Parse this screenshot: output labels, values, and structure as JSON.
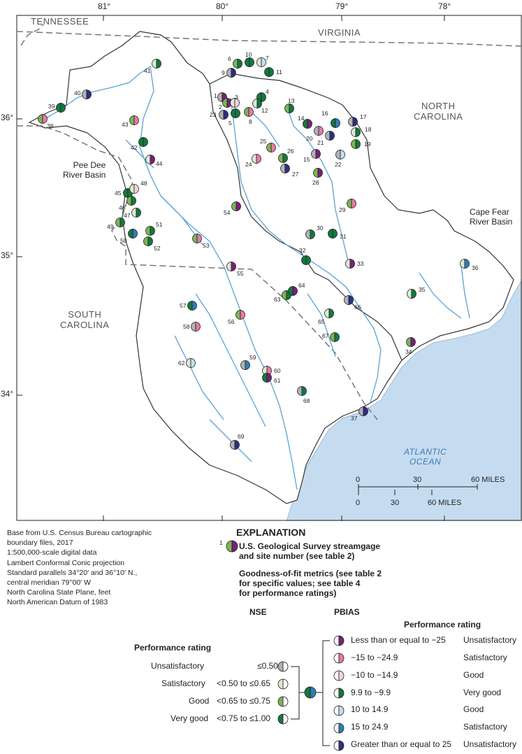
{
  "map": {
    "longitude_labels": [
      "81°",
      "80°",
      "79°",
      "78°"
    ],
    "latitude_labels": [
      "36°",
      "35°",
      "34°"
    ],
    "state_labels": {
      "tennessee": "TENNESSEE",
      "virginia": "VIRGINIA",
      "north_carolina": [
        "NORTH",
        "CAROLINA"
      ],
      "south_carolina": [
        "SOUTH",
        "CAROLINA"
      ]
    },
    "basin_labels": {
      "pee_dee": [
        "Pee Dee",
        "River Basin"
      ],
      "cape_fear": [
        "Cape Fear",
        "River Basin"
      ]
    },
    "ocean_label": [
      "ATLANTIC",
      "OCEAN"
    ],
    "scale_bar": {
      "miles": [
        "0",
        "30",
        "60 MILES"
      ],
      "kilometers": [
        "0",
        "30",
        "60 MILES"
      ]
    },
    "colors": {
      "water": "#c5dcf0",
      "river": "#5aa2d4",
      "basin_fill": "#ffffff",
      "nse": {
        "unsatisfactory": "#b1b3b6",
        "satisfactory": "#d9ead3",
        "good": "#7eb356",
        "very_good": "#127a3f"
      },
      "pbias": {
        "le_-25": "#7b1f7a",
        "-15_to_-24.9": "#e879a8",
        "-10_to_-14.9": "#f7d4dc",
        "9.9_to_-9.9": "#127a3f",
        "10_to_14.9": "#bfe0f1",
        "15_to_24.9": "#2a7fb8",
        "ge_25": "#2b2f84"
      }
    },
    "sites": [
      {
        "id": "1",
        "nse": "unsatisfactory",
        "pbias": "le_-25"
      },
      {
        "id": "2",
        "nse": "good",
        "pbias": "le_-25"
      },
      {
        "id": "3",
        "nse": "satisfactory",
        "pbias": "-10_to_-14.9"
      },
      {
        "id": "4",
        "nse": "very_good",
        "pbias": "9.9_to_-9.9"
      },
      {
        "id": "5",
        "nse": "very_good",
        "pbias": "9.9_to_-9.9"
      },
      {
        "id": "6",
        "nse": "good",
        "pbias": "9.9_to_-9.9"
      },
      {
        "id": "7",
        "nse": "satisfactory",
        "pbias": "10_to_14.9"
      },
      {
        "id": "8",
        "nse": "good",
        "pbias": "-15_to_-24.9"
      },
      {
        "id": "9",
        "nse": "unsatisfactory",
        "pbias": "ge_25"
      },
      {
        "id": "10",
        "nse": "very_good",
        "pbias": "9.9_to_-9.9"
      },
      {
        "id": "11",
        "nse": "very_good",
        "pbias": "9.9_to_-9.9"
      },
      {
        "id": "12",
        "nse": "satisfactory",
        "pbias": "9.9_to_-9.9"
      },
      {
        "id": "13",
        "nse": "good",
        "pbias": "9.9_to_-9.9"
      },
      {
        "id": "14",
        "nse": "very_good",
        "pbias": "le_-25"
      },
      {
        "id": "15",
        "nse": "unsatisfactory",
        "pbias": "le_-25"
      },
      {
        "id": "16",
        "nse": "very_good",
        "pbias": "15_to_24.9"
      },
      {
        "id": "17",
        "nse": "unsatisfactory",
        "pbias": "ge_25"
      },
      {
        "id": "18",
        "nse": "satisfactory",
        "pbias": "9.9_to_-9.9"
      },
      {
        "id": "19",
        "nse": "good",
        "pbias": "9.9_to_-9.9"
      },
      {
        "id": "20",
        "nse": "unsatisfactory",
        "pbias": "-15_to_-24.9"
      },
      {
        "id": "21",
        "nse": "unsatisfactory",
        "pbias": "ge_25"
      },
      {
        "id": "22",
        "nse": "unsatisfactory",
        "pbias": "10_to_14.9"
      },
      {
        "id": "23",
        "nse": "unsatisfactory",
        "pbias": "ge_25"
      },
      {
        "id": "24",
        "nse": "satisfactory",
        "pbias": "-15_to_-24.9"
      },
      {
        "id": "25",
        "nse": "good",
        "pbias": "-15_to_-24.9"
      },
      {
        "id": "26",
        "nse": "good",
        "pbias": "9.9_to_-9.9"
      },
      {
        "id": "27",
        "nse": "unsatisfactory",
        "pbias": "ge_25"
      },
      {
        "id": "28",
        "nse": "good",
        "pbias": "le_-25"
      },
      {
        "id": "29",
        "nse": "good",
        "pbias": "-15_to_-24.9"
      },
      {
        "id": "30",
        "nse": "unsatisfactory",
        "pbias": "9.9_to_-9.9"
      },
      {
        "id": "31",
        "nse": "very_good",
        "pbias": "9.9_to_-9.9"
      },
      {
        "id": "32",
        "nse": "very_good",
        "pbias": "9.9_to_-9.9"
      },
      {
        "id": "33",
        "nse": "satisfactory",
        "pbias": "le_-25"
      },
      {
        "id": "34",
        "nse": "good",
        "pbias": "le_-25"
      },
      {
        "id": "35",
        "nse": "satisfactory",
        "pbias": "9.9_to_-9.9"
      },
      {
        "id": "36",
        "nse": "satisfactory",
        "pbias": "15_to_24.9"
      },
      {
        "id": "37",
        "nse": "unsatisfactory",
        "pbias": "ge_25"
      },
      {
        "id": "38",
        "nse": "good",
        "pbias": "-15_to_-24.9"
      },
      {
        "id": "39",
        "nse": "very_good",
        "pbias": "9.9_to_-9.9"
      },
      {
        "id": "40",
        "nse": "unsatisfactory",
        "pbias": "ge_25"
      },
      {
        "id": "41",
        "nse": "satisfactory",
        "pbias": "9.9_to_-9.9"
      },
      {
        "id": "42",
        "nse": "very_good",
        "pbias": "9.9_to_-9.9"
      },
      {
        "id": "43",
        "nse": "good",
        "pbias": "-15_to_-24.9"
      },
      {
        "id": "44",
        "nse": "satisfactory",
        "pbias": "le_-25"
      },
      {
        "id": "45",
        "nse": "very_good",
        "pbias": "9.9_to_-9.9"
      },
      {
        "id": "46",
        "nse": "good",
        "pbias": "9.9_to_-9.9"
      },
      {
        "id": "47",
        "nse": "satisfactory",
        "pbias": "9.9_to_-9.9"
      },
      {
        "id": "48",
        "nse": "satisfactory",
        "pbias": "-10_to_-14.9"
      },
      {
        "id": "49",
        "nse": "good",
        "pbias": "9.9_to_-9.9"
      },
      {
        "id": "50",
        "nse": "very_good",
        "pbias": "15_to_24.9"
      },
      {
        "id": "51",
        "nse": "good",
        "pbias": "9.9_to_-9.9"
      },
      {
        "id": "52",
        "nse": "good",
        "pbias": "9.9_to_-9.9"
      },
      {
        "id": "53",
        "nse": "good",
        "pbias": "-15_to_-24.9"
      },
      {
        "id": "54",
        "nse": "good",
        "pbias": "le_-25"
      },
      {
        "id": "55",
        "nse": "satisfactory",
        "pbias": "le_-25"
      },
      {
        "id": "56",
        "nse": "good",
        "pbias": "-15_to_-24.9"
      },
      {
        "id": "57",
        "nse": "very_good",
        "pbias": "15_to_24.9"
      },
      {
        "id": "58",
        "nse": "unsatisfactory",
        "pbias": "-15_to_-24.9"
      },
      {
        "id": "59",
        "nse": "unsatisfactory",
        "pbias": "15_to_24.9"
      },
      {
        "id": "60",
        "nse": "satisfactory",
        "pbias": "-15_to_-24.9"
      },
      {
        "id": "61",
        "nse": "very_good",
        "pbias": "le_-25"
      },
      {
        "id": "62",
        "nse": "satisfactory",
        "pbias": "10_to_14.9"
      },
      {
        "id": "63",
        "nse": "good",
        "pbias": "9.9_to_-9.9"
      },
      {
        "id": "64",
        "nse": "very_good",
        "pbias": "le_-25"
      },
      {
        "id": "65",
        "nse": "satisfactory",
        "pbias": "9.9_to_-9.9"
      },
      {
        "id": "66",
        "nse": "unsatisfactory",
        "pbias": "ge_25"
      },
      {
        "id": "67",
        "nse": "good",
        "pbias": "9.9_to_-9.9"
      },
      {
        "id": "68",
        "nse": "unsatisfactory",
        "pbias": "9.9_to_-9.9"
      },
      {
        "id": "69",
        "nse": "unsatisfactory",
        "pbias": "ge_25"
      }
    ]
  },
  "source_note": [
    "Base from U.S. Census Bureau cartographic",
    "boundary files, 2017",
    "1:500,000-scale digital data",
    "Lambert Conformal Conic projection",
    "Standard parallels 34°20′ and 36°10′ N.,",
    "central meridian 79°00′ W",
    "North Carolina State Plane, feet",
    "North American Datum of 1983"
  ],
  "explanation": {
    "title": "EXPLANATION",
    "sample_site_number": "1",
    "streamgage_label": [
      "U.S. Geological Survey streamgage",
      "and site number (see table 2)"
    ],
    "metrics_label": [
      "Goodness-of-fit metrics (see table 2",
      "for specific values; see table 4",
      "for performance ratings)"
    ],
    "nse_header": "NSE",
    "pbias_header": "PBIAS",
    "performance_rating_nse": "Performance rating",
    "performance_rating_pbias": "Performance rating",
    "nse_rows": [
      {
        "rating": "Unsatisfactory",
        "range": "≤0.50",
        "key": "unsatisfactory"
      },
      {
        "rating": "Satisfactory",
        "range": "<0.50 to ≤0.65",
        "key": "satisfactory"
      },
      {
        "rating": "Good",
        "range": "<0.65 to ≤0.75",
        "key": "good"
      },
      {
        "rating": "Very good",
        "range": "<0.75 to ≤1.00",
        "key": "very_good"
      }
    ],
    "pbias_rows": [
      {
        "range": "Less than or equal to −25",
        "rating": "Unsatisfactory",
        "key": "le_-25"
      },
      {
        "range": "−15 to −24.9",
        "rating": "Satisfactory",
        "key": "-15_to_-24.9"
      },
      {
        "range": "−10 to −14.9",
        "rating": "Good",
        "key": "-10_to_-14.9"
      },
      {
        "range": "9.9 to −9.9",
        "rating": "Very good",
        "key": "9.9_to_-9.9"
      },
      {
        "range": "10 to 14.9",
        "rating": "Good",
        "key": "10_to_14.9"
      },
      {
        "range": "15 to 24.9",
        "rating": "Satisfactory",
        "key": "15_to_24.9"
      },
      {
        "range": "Greater than or equal to 25",
        "rating": "Unsatisfactory",
        "key": "ge_25"
      }
    ]
  }
}
